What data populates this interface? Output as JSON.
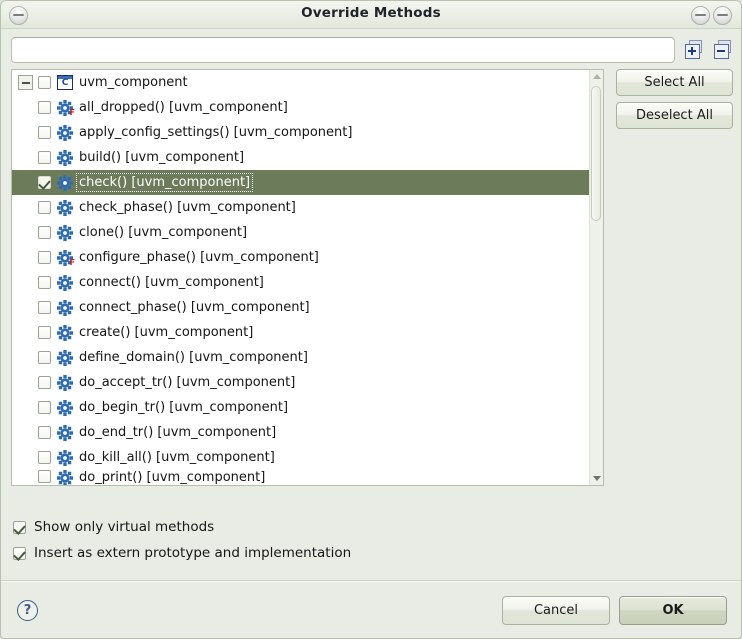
{
  "window": {
    "title": "Override Methods",
    "buttons": {
      "left_icon": "minimize-icon",
      "right_icon_1": "minimize-icon",
      "right_icon_2": "maximize-icon"
    }
  },
  "filter": {
    "value": "",
    "placeholder": "",
    "expand_all_label": "Expand All",
    "collapse_all_label": "Collapse All"
  },
  "tree": {
    "rows": [
      {
        "label": "uvm_component",
        "type": "class",
        "icon": "class-icon",
        "checked": false,
        "selected": false,
        "indent": 0,
        "twisty": "collapse"
      },
      {
        "label": "all_dropped() [uvm_component]",
        "type": "method",
        "icon": "method-gear-icon",
        "overlay": "F",
        "checked": false,
        "selected": false,
        "indent": 1
      },
      {
        "label": "apply_config_settings() [uvm_component]",
        "type": "method",
        "icon": "method-gear-icon",
        "overlay": "",
        "checked": false,
        "selected": false,
        "indent": 1
      },
      {
        "label": "build() [uvm_component]",
        "type": "method",
        "icon": "method-gear-icon",
        "overlay": "",
        "checked": false,
        "selected": false,
        "indent": 1
      },
      {
        "label": "check() [uvm_component]",
        "type": "method",
        "icon": "method-gear-icon",
        "overlay": "",
        "checked": true,
        "selected": true,
        "indent": 1
      },
      {
        "label": "check_phase() [uvm_component]",
        "type": "method",
        "icon": "method-gear-icon",
        "overlay": "",
        "checked": false,
        "selected": false,
        "indent": 1
      },
      {
        "label": "clone() [uvm_component]",
        "type": "method",
        "icon": "method-gear-icon",
        "overlay": "",
        "checked": false,
        "selected": false,
        "indent": 1
      },
      {
        "label": "configure_phase() [uvm_component]",
        "type": "method",
        "icon": "method-gear-icon",
        "overlay": "F",
        "checked": false,
        "selected": false,
        "indent": 1
      },
      {
        "label": "connect() [uvm_component]",
        "type": "method",
        "icon": "method-gear-icon",
        "overlay": "",
        "checked": false,
        "selected": false,
        "indent": 1
      },
      {
        "label": "connect_phase() [uvm_component]",
        "type": "method",
        "icon": "method-gear-icon",
        "overlay": "",
        "checked": false,
        "selected": false,
        "indent": 1
      },
      {
        "label": "create() [uvm_component]",
        "type": "method",
        "icon": "method-gear-icon",
        "overlay": "",
        "checked": false,
        "selected": false,
        "indent": 1
      },
      {
        "label": "define_domain() [uvm_component]",
        "type": "method",
        "icon": "method-gear-icon",
        "overlay": "",
        "checked": false,
        "selected": false,
        "indent": 1
      },
      {
        "label": "do_accept_tr() [uvm_component]",
        "type": "method",
        "icon": "method-gear-icon",
        "overlay": "",
        "checked": false,
        "selected": false,
        "indent": 1
      },
      {
        "label": "do_begin_tr() [uvm_component]",
        "type": "method",
        "icon": "method-gear-icon",
        "overlay": "",
        "checked": false,
        "selected": false,
        "indent": 1
      },
      {
        "label": "do_end_tr() [uvm_component]",
        "type": "method",
        "icon": "method-gear-icon",
        "overlay": "",
        "checked": false,
        "selected": false,
        "indent": 1
      },
      {
        "label": "do_kill_all() [uvm_component]",
        "type": "method",
        "icon": "method-gear-icon",
        "overlay": "",
        "checked": false,
        "selected": false,
        "indent": 1
      },
      {
        "label": "do_print() [uvm_component]",
        "type": "method",
        "icon": "method-gear-icon",
        "overlay": "",
        "checked": false,
        "selected": false,
        "indent": 1,
        "clipped": true
      }
    ]
  },
  "side": {
    "select_all_label": "Select All",
    "deselect_all_label": "Deselect All"
  },
  "options": [
    {
      "label": "Show only virtual methods",
      "checked": true
    },
    {
      "label": "Insert as extern prototype and implementation",
      "checked": true
    }
  ],
  "footer": {
    "help_label": "?",
    "cancel_label": "Cancel",
    "ok_label": "OK"
  },
  "colors": {
    "dialog_bg": "#e9ece4",
    "selection": "#6c7c5b",
    "tree_bg": "#ffffff",
    "icon_blue": "#2e6bb0",
    "overlay_red": "#c0221a"
  }
}
